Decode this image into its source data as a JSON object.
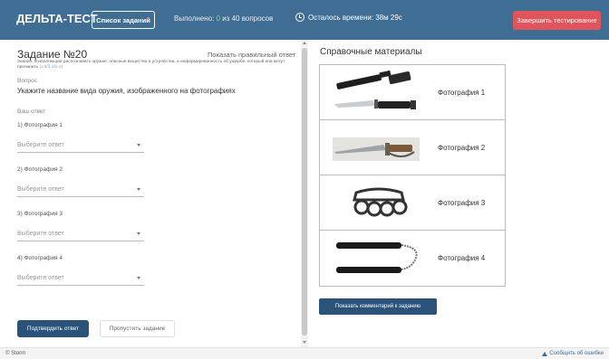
{
  "header": {
    "brand": "ДЕЛЬТА-ТЕСТ",
    "tasks_button": "Список заданий",
    "progress_prefix": "Выполнено: ",
    "progress_done": "0",
    "progress_suffix": " из 40 вопросов",
    "timer": "Осталось времени: 38м 29с",
    "finish_button": "Завершить тестирование",
    "colors": {
      "bar": "#3f6d93",
      "finish": "#e0545b",
      "done": "#7fe07f"
    }
  },
  "task": {
    "title": "Задание №20",
    "show_answer": "Показать правильный ответ",
    "competence": "Знания, позволяющие распознавать оружие, опасные вещества и устройства, и информированность об ущербе, который они могут причинить",
    "competence_code": " (з.6/б-2/2.4)",
    "question_label": "Вопрос",
    "question": "Укажите название вида оружия, изображенного на фотографиях",
    "answer_label": "Ваш ответ",
    "items": [
      {
        "label": "1) Фотография 1",
        "placeholder": "Выберите ответ"
      },
      {
        "label": "2) Фотография 2",
        "placeholder": "Выберите ответ"
      },
      {
        "label": "3) Фотография 3",
        "placeholder": "Выберите ответ"
      },
      {
        "label": "4) Фотография 4",
        "placeholder": "Выберите ответ"
      }
    ],
    "confirm_button": "Подтвердить ответ",
    "skip_button": "Пропустить задание"
  },
  "references": {
    "title": "Справочные материалы",
    "photos": [
      {
        "label": "Фотография 1",
        "icon": "bayonet-knife-with-sheath"
      },
      {
        "label": "Фотография 2",
        "icon": "knife-with-knuckle-guard"
      },
      {
        "label": "Фотография 3",
        "icon": "brass-knuckles"
      },
      {
        "label": "Фотография 4",
        "icon": "nunchaku"
      }
    ],
    "comment_button": "Показать комментарий к заданию"
  },
  "footer": {
    "copyright": "© Storm",
    "report": "Сообщить об ошибке"
  }
}
